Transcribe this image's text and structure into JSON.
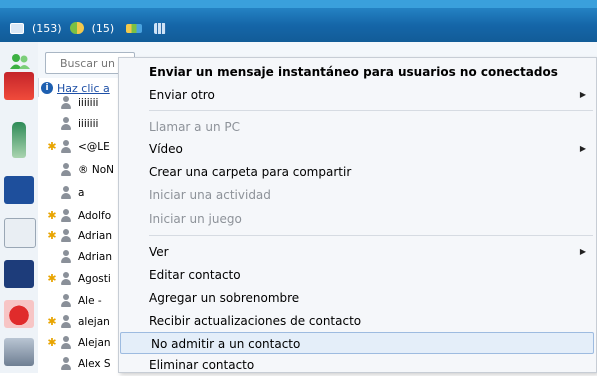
{
  "topbar": {
    "mail_count": "(153)",
    "contacts_count": "(15)"
  },
  "search": {
    "placeholder": "Buscar un"
  },
  "info": {
    "link_text": "Haz clic a"
  },
  "contacts": [
    {
      "name": "iiiiiii",
      "favorite": false
    },
    {
      "name": "iiiiiii",
      "favorite": false
    },
    {
      "name": "<@LE",
      "favorite": true
    },
    {
      "name": "® NoN",
      "favorite": false
    },
    {
      "name": "a",
      "favorite": false
    },
    {
      "name": "Adolfo",
      "favorite": true
    },
    {
      "name": "Adrian",
      "favorite": true
    },
    {
      "name": "Adrian",
      "favorite": false
    },
    {
      "name": "Agosti",
      "favorite": true
    },
    {
      "name": "Ale  -",
      "favorite": false
    },
    {
      "name": "alejan",
      "favorite": true
    },
    {
      "name": "Alejan",
      "favorite": true
    },
    {
      "name": "Alex S",
      "favorite": false
    }
  ],
  "menu": {
    "send_offline_im": "Enviar un mensaje instantáneo para usuarios no conectados",
    "send_other": "Enviar otro",
    "call_pc": "Llamar a un PC",
    "video": "Vídeo",
    "create_shared_folder": "Crear una carpeta para compartir",
    "start_activity": "Iniciar una actividad",
    "start_game": "Iniciar un juego",
    "view": "Ver",
    "edit_contact": "Editar contacto",
    "add_nickname": "Agregar un sobrenombre",
    "receive_updates": "Recibir actualizaciones de contacto",
    "block_contact": "No admitir a un contacto",
    "delete_contact": "Eliminar contacto"
  },
  "colors": {
    "accent_blue": "#1566a8",
    "favorite_star": "#e8a400",
    "menu_hover": "#e4eef9"
  }
}
